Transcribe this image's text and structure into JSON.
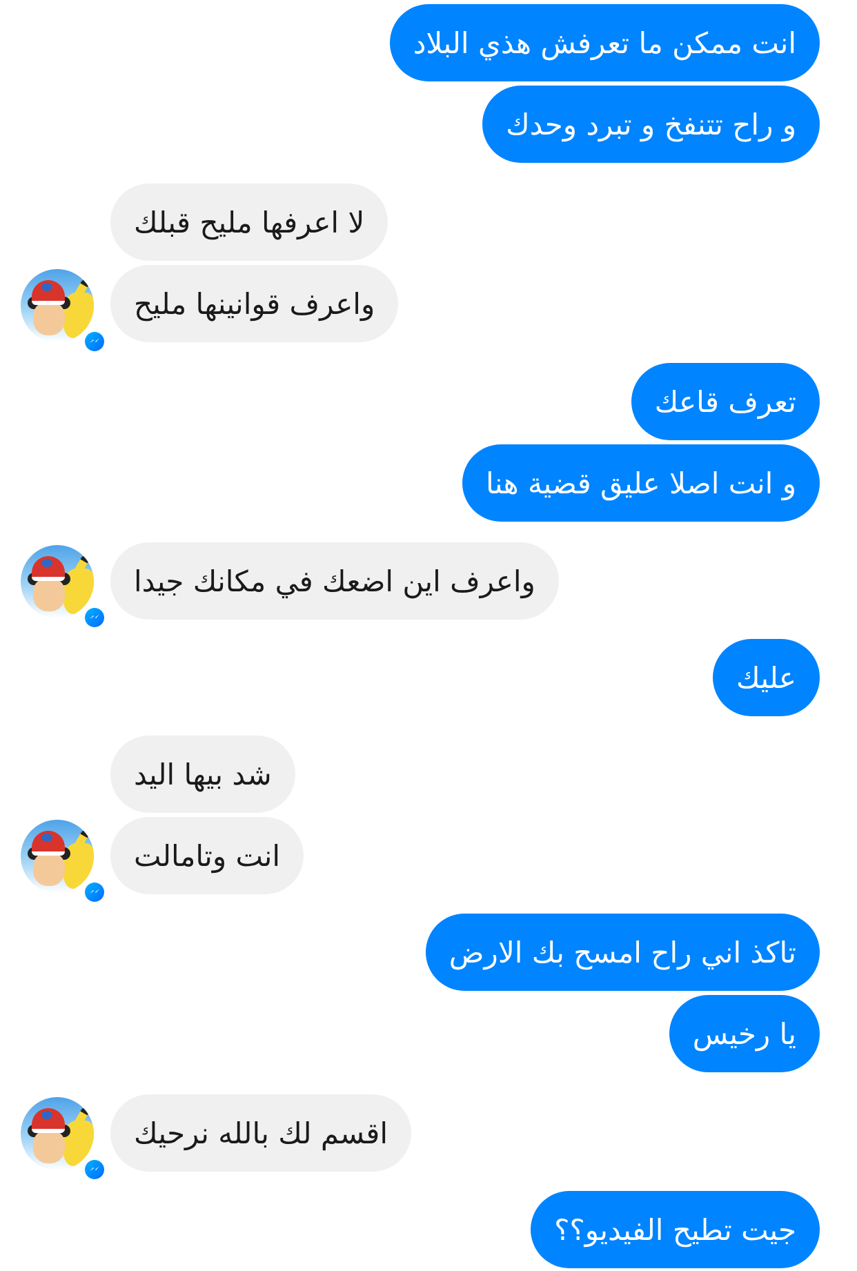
{
  "conversation": {
    "messages": [
      {
        "sender": "me",
        "text": "انت ممكن ما تعرفش هذي البلاد"
      },
      {
        "sender": "me",
        "text": "و راح تتنفخ و تبرد وحدك"
      },
      {
        "sender": "them",
        "text": "لا اعرفها مليح قبلك"
      },
      {
        "sender": "them",
        "text": "واعرف قوانينها مليح"
      },
      {
        "sender": "me",
        "text": "تعرف قاعك"
      },
      {
        "sender": "me",
        "text": "و انت اصلا عليق قضية هنا"
      },
      {
        "sender": "them",
        "text": "واعرف اين اضعك في مكانك جيدا"
      },
      {
        "sender": "me",
        "text": "عليك"
      },
      {
        "sender": "them",
        "text": "شد بيها اليد"
      },
      {
        "sender": "them",
        "text": "انت وتامالت"
      },
      {
        "sender": "me",
        "text": "تاكذ اني راح امسح بك الارض"
      },
      {
        "sender": "me",
        "text": "يا رخيس"
      },
      {
        "sender": "them",
        "text": "اقسم لك بالله نرحيك"
      },
      {
        "sender": "me",
        "text": "جيت تطيح الفيديو؟؟"
      }
    ]
  },
  "colors": {
    "outgoing_bubble": "#0084ff",
    "incoming_bubble": "#f0f0f0",
    "background": "#ffffff"
  },
  "icons": {
    "avatar": "profile-avatar",
    "badge": "messenger-badge-icon"
  }
}
